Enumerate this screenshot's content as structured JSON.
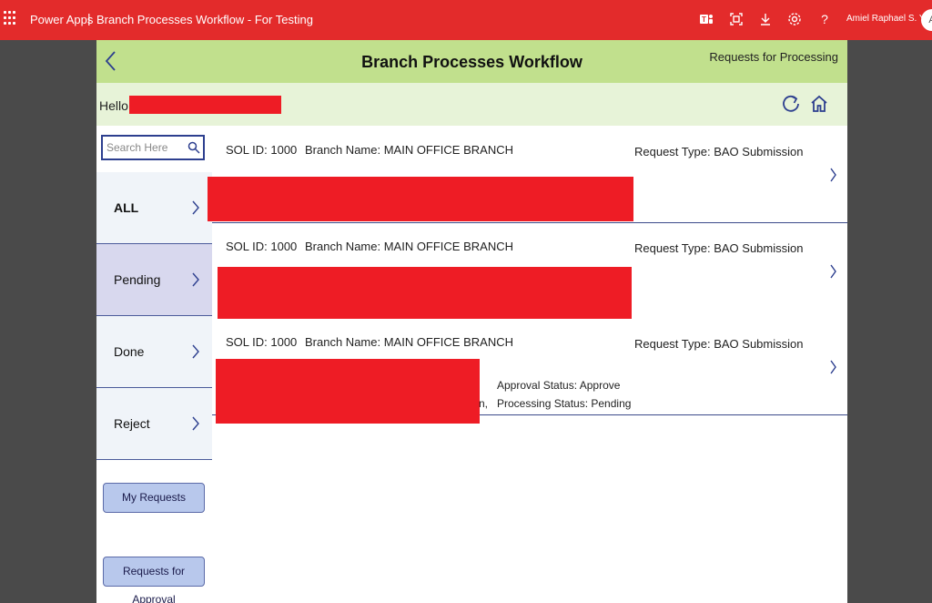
{
  "topbar": {
    "brand": "Power Apps",
    "separator": "|",
    "app_title": "Branch Processes Workflow - For Testing",
    "user_name": "Amiel Raphael S. Y...",
    "avatar_initial": "A",
    "icons": [
      "teams-icon",
      "fit-screen-icon",
      "download-icon",
      "settings-icon",
      "help-icon"
    ],
    "color": "#e32b2b"
  },
  "header": {
    "title": "Branch Processes Workflow",
    "requests_link": "Requests for Processing",
    "color": "#c1e08d"
  },
  "greeting": {
    "hello": "Hello,"
  },
  "search": {
    "placeholder": "Search Here"
  },
  "nav": {
    "items": [
      {
        "label": "ALL"
      },
      {
        "label": "Pending"
      },
      {
        "label": "Done"
      },
      {
        "label": "Reject"
      }
    ],
    "active": "Pending"
  },
  "buttons": {
    "my_requests": "My Requests",
    "requests_for_approval": "Requests for Approval"
  },
  "requests": [
    {
      "sol_id": "SOL ID: 1000",
      "branch_name": "Branch Name: MAIN OFFICE BRANCH",
      "request_type": "Request Type: BAO Submission"
    },
    {
      "sol_id": "SOL ID: 1000",
      "branch_name": "Branch Name: MAIN OFFICE BRANCH",
      "request_type": "Request Type: BAO Submission"
    },
    {
      "sol_id": "SOL ID: 1000",
      "branch_name": "Branch Name: MAIN OFFICE BRANCH",
      "request_type": "Request Type: BAO Submission",
      "fragment": "n,",
      "approval_status": "Approval Status: Approve",
      "processing_status": "Processing Status: Pending"
    }
  ],
  "colors": {
    "redaction": "#ee1c25",
    "accent": "#2d3f8f"
  }
}
